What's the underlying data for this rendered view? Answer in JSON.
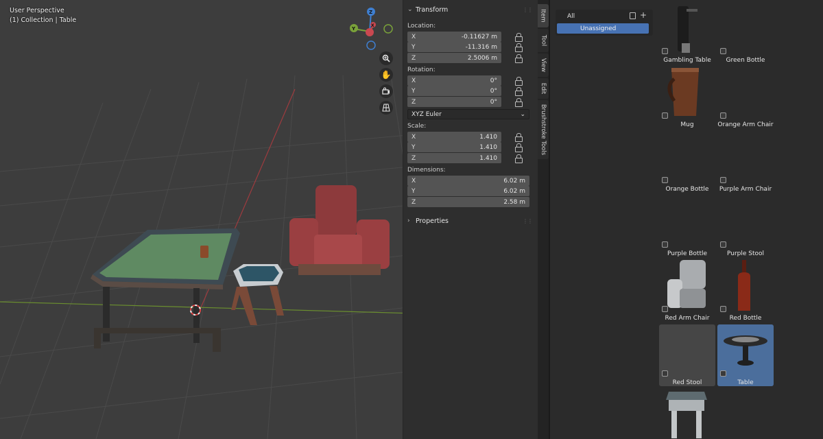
{
  "viewport": {
    "mode": "User Perspective",
    "collection": "(1) Collection | Table",
    "gizmo": {
      "z": "Z",
      "y": "Y",
      "x": "X"
    },
    "nav_icons": [
      "zoom-icon",
      "hand-pan-icon",
      "camera-icon",
      "grid-icon"
    ]
  },
  "transform": {
    "title": "Transform",
    "location_label": "Location:",
    "location": [
      {
        "axis": "X",
        "value": "-0.11627 m"
      },
      {
        "axis": "Y",
        "value": "-11.316 m"
      },
      {
        "axis": "Z",
        "value": "2.5006 m"
      }
    ],
    "rotation_label": "Rotation:",
    "rotation": [
      {
        "axis": "X",
        "value": "0°"
      },
      {
        "axis": "Y",
        "value": "0°"
      },
      {
        "axis": "Z",
        "value": "0°"
      }
    ],
    "rotation_mode": "XYZ Euler",
    "scale_label": "Scale:",
    "scale": [
      {
        "axis": "X",
        "value": "1.410"
      },
      {
        "axis": "Y",
        "value": "1.410"
      },
      {
        "axis": "Z",
        "value": "1.410"
      }
    ],
    "dimensions_label": "Dimensions:",
    "dimensions": [
      {
        "axis": "X",
        "value": "6.02 m"
      },
      {
        "axis": "Y",
        "value": "6.02 m"
      },
      {
        "axis": "Z",
        "value": "2.58 m"
      }
    ]
  },
  "properties": {
    "title": "Properties"
  },
  "tabs": [
    "Item",
    "Tool",
    "View",
    "Edit",
    "Brushstroke Tools"
  ],
  "catalogs": {
    "all": "All",
    "selected": "Unassigned"
  },
  "assets": [
    {
      "name": "Gambling Table",
      "selected": false
    },
    {
      "name": "Green Bottle",
      "selected": false
    },
    {
      "name": "Mug",
      "selected": false
    },
    {
      "name": "Orange Arm Chair",
      "selected": false
    },
    {
      "name": "Orange Bottle",
      "selected": false
    },
    {
      "name": "Purple Arm Chair",
      "selected": false
    },
    {
      "name": "Purple Bottle",
      "selected": false
    },
    {
      "name": "Purple Stool",
      "selected": false
    },
    {
      "name": "Red Arm Chair",
      "selected": false
    },
    {
      "name": "Red Bottle",
      "selected": false
    },
    {
      "name": "Red Stool",
      "selected": false
    },
    {
      "name": "Table",
      "selected": true
    }
  ],
  "colors": {
    "selection": "#4772b3",
    "x_axis": "#c94850",
    "y_axis": "#7aa23a",
    "z_axis": "#3f7fd0"
  }
}
